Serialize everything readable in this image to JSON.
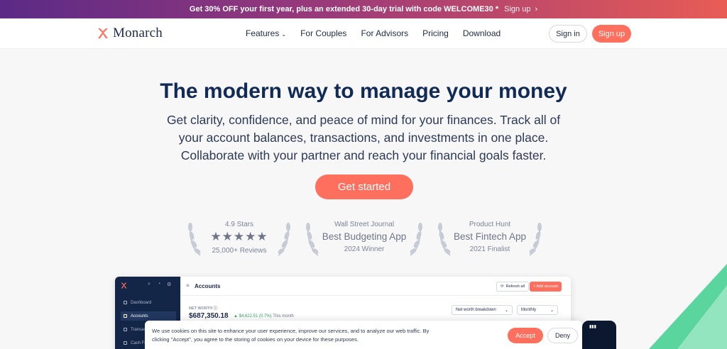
{
  "banner": {
    "text": "Get 30% OFF your first year, plus an extended 30-day trial with code WELCOME30 *",
    "link": "Sign up",
    "arrow_icon": "arrow-right-icon"
  },
  "nav": {
    "brand": "Monarch",
    "logo_icon": "monarch-butterfly-logo",
    "items": [
      {
        "label": "Features",
        "has_dropdown": true
      },
      {
        "label": "For Couples"
      },
      {
        "label": "For Advisors"
      },
      {
        "label": "Pricing"
      },
      {
        "label": "Download"
      }
    ],
    "signin": "Sign in",
    "signup": "Sign up"
  },
  "hero": {
    "headline": "The modern way to manage your money",
    "subtitle": "Get clarity, confidence, and peace of mind for your finances. Track all of your account balances, transactions, and investments in one place. Collaborate with your partner and reach your financial goals faster.",
    "cta": "Get started"
  },
  "awards": [
    {
      "top": "4.9 Stars",
      "stars": "★★★★★",
      "rating": 5,
      "bottom": "25,000+ Reviews"
    },
    {
      "top": "Wall Street Journal",
      "title": "Best Budgeting App",
      "bottom": "2024 Winner"
    },
    {
      "top": "Product Hunt",
      "title": "Best Fintech App",
      "bottom": "2021 Finalist"
    }
  ],
  "dashboard": {
    "sidebar": [
      {
        "label": "Dashboard",
        "icon": "dashboard-icon"
      },
      {
        "label": "Accounts",
        "icon": "accounts-icon",
        "active": true
      },
      {
        "label": "Transactions",
        "icon": "transactions-icon"
      },
      {
        "label": "Cash Flow",
        "icon": "cash-flow-icon"
      }
    ],
    "title": "Accounts",
    "refresh": "Refresh all",
    "add": "+ Add account",
    "net_worth_label": "NET WORTH",
    "net_worth_value": "$687,350.18",
    "change": "▲ $4,622.51 (0.7%)",
    "change_period": "This month",
    "breakdown": "Net worth breakdown",
    "period": "Monthly"
  },
  "cookie": {
    "text": "We use cookies on this site to enhance your user experience, improve our services, and to analyze our web traffic. By clicking \"Accept\", you agree to the storing of cookies on your device for these purposes.",
    "accept": "Accept",
    "deny": "Deny"
  },
  "colors": {
    "accent": "#ff6f5e",
    "navy": "#112a56",
    "sidebar": "#132648",
    "green": "#3ecf8e"
  }
}
